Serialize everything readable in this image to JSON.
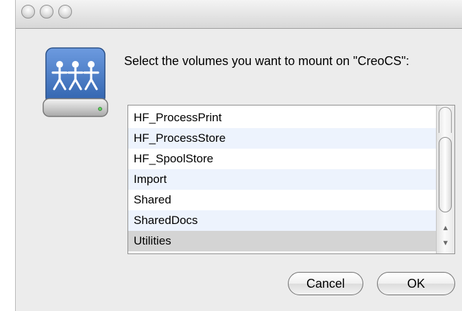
{
  "dialog": {
    "prompt": "Select the volumes you want to mount on \"CreoCS\":",
    "icon": "network-share-drive-icon"
  },
  "volumes": [
    "HF_ProcessPrint",
    "HF_ProcessStore",
    "HF_SpoolStore",
    "Import",
    "Shared",
    "SharedDocs",
    "Utilities"
  ],
  "selected_volume": "Utilities",
  "buttons": {
    "cancel": "Cancel",
    "ok": "OK"
  },
  "colors": {
    "window_bg": "#ececec",
    "row_alt": "#edf3fd",
    "row_selected": "#d4d4d4",
    "icon_blue": "#3f78c0"
  }
}
